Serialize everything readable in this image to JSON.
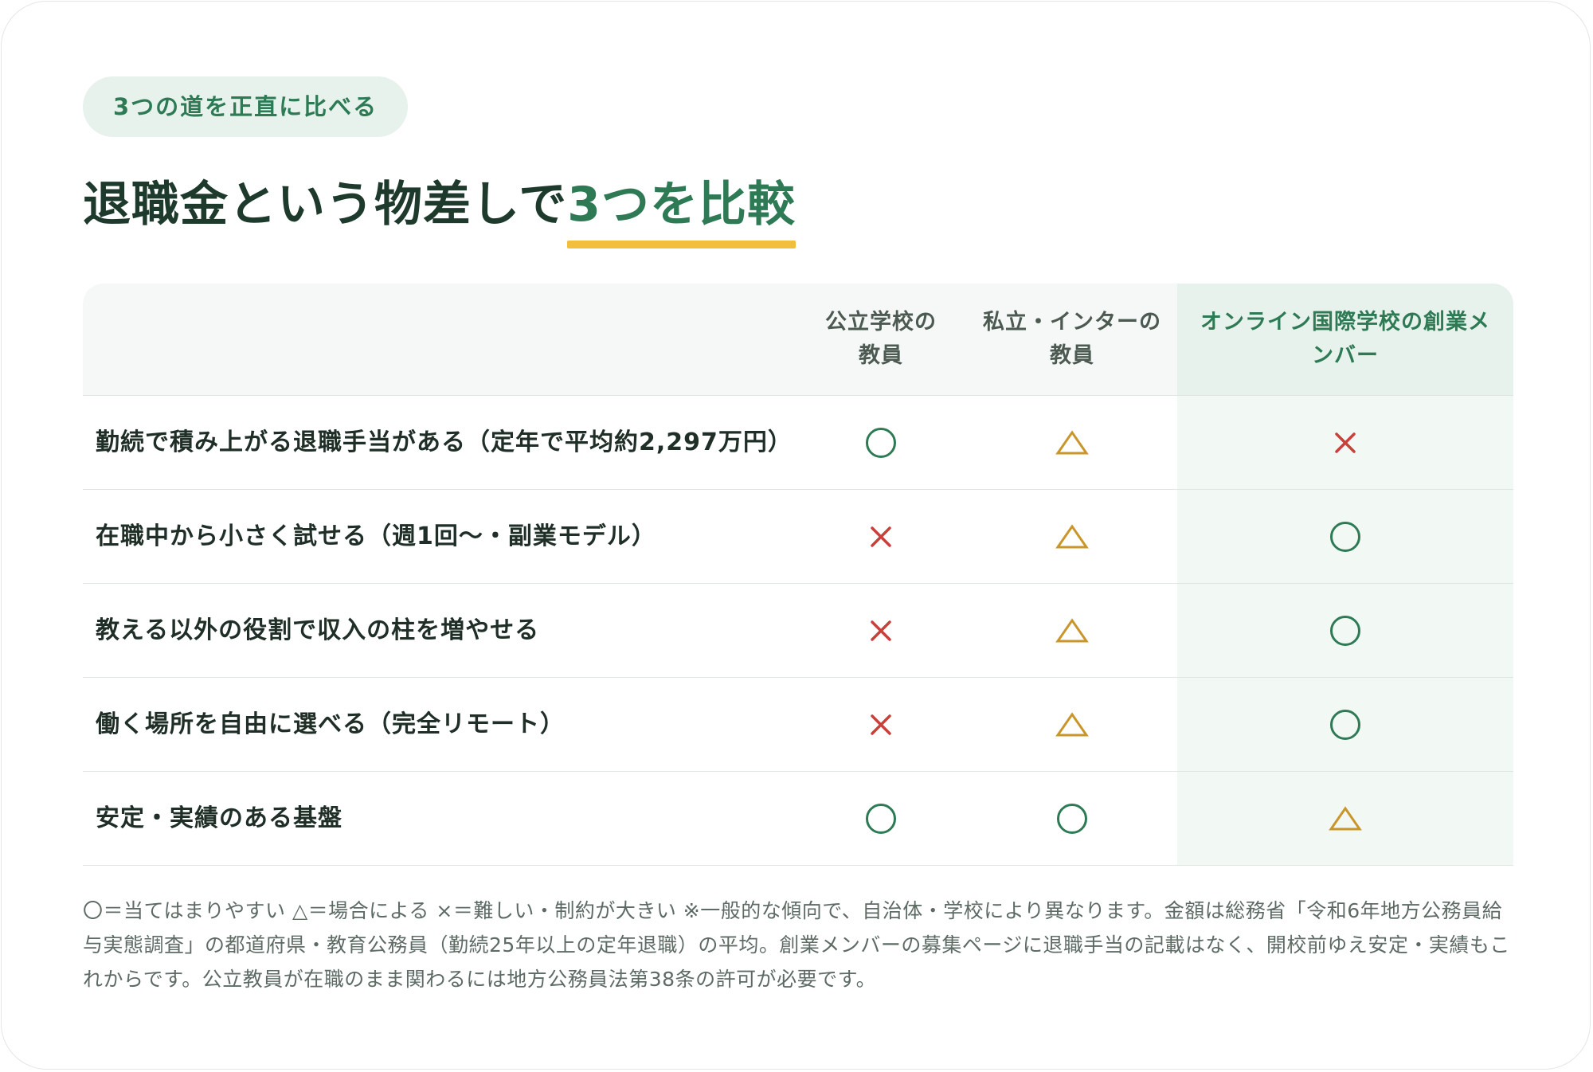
{
  "badge": "3つの道を正直に比べる",
  "title": {
    "main": "退職金という物差しで",
    "highlight": "3つを比較"
  },
  "table": {
    "columns": [
      {
        "line1": "公立学校の",
        "line2": "教員"
      },
      {
        "line1": "私立・インターの",
        "line2": "教員"
      },
      {
        "line1": "オンライン国際学校の創業メ",
        "line2": "ンバー"
      }
    ],
    "rows": [
      {
        "label": "勤続で積み上がる退職手当がある（定年で平均約2,297万円）",
        "marks": [
          "circle",
          "triangle",
          "cross"
        ]
      },
      {
        "label": "在職中から小さく試せる（週1回〜・副業モデル）",
        "marks": [
          "cross",
          "triangle",
          "circle"
        ]
      },
      {
        "label": "教える以外の役割で収入の柱を増やせる",
        "marks": [
          "cross",
          "triangle",
          "circle"
        ]
      },
      {
        "label": "働く場所を自由に選べる（完全リモート）",
        "marks": [
          "cross",
          "triangle",
          "circle"
        ]
      },
      {
        "label": "安定・実績のある基盤",
        "marks": [
          "circle",
          "circle",
          "triangle"
        ]
      }
    ]
  },
  "note": "〇＝当てはまりやすい △＝場合による ×＝難しい・制約が大きい ※一般的な傾向で、自治体・学校により異なります。金額は総務省「令和6年地方公務員給与実態調査」の都道府県・教育公務員（勤続25年以上の定年退職）の平均。創業メンバーの募集ページに退職手当の記載はなく、開校前ゆえ安定・実績もこれからです。公立教員が在職のまま関わるには地方公務員法第38条の許可が必要です。",
  "colors": {
    "green": "#2d7a55",
    "amber": "#c9962c",
    "red": "#c9403a",
    "underline": "#f3be3c"
  }
}
